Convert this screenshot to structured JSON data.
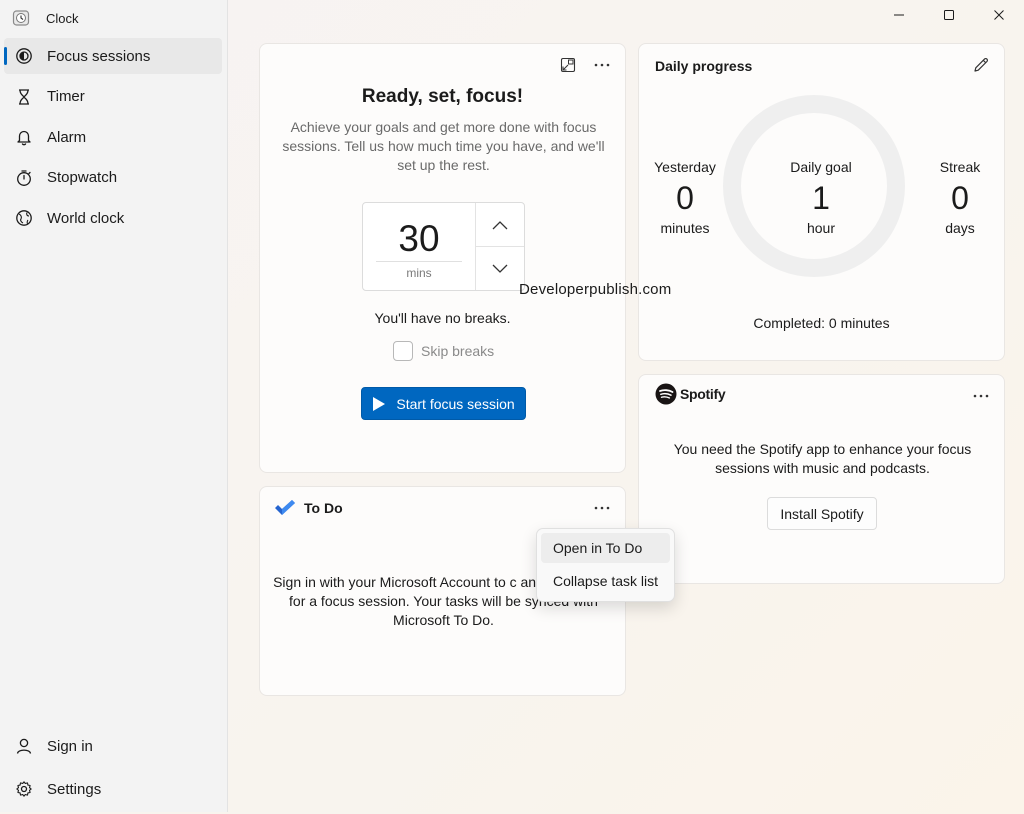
{
  "app": {
    "title": "Clock"
  },
  "sidebar": {
    "items": [
      {
        "label": "Focus sessions",
        "icon": "focus-icon",
        "active": true
      },
      {
        "label": "Timer",
        "icon": "hourglass-icon"
      },
      {
        "label": "Alarm",
        "icon": "bell-icon"
      },
      {
        "label": "Stopwatch",
        "icon": "stopwatch-icon"
      },
      {
        "label": "World clock",
        "icon": "globe-icon"
      }
    ],
    "bottom": [
      {
        "label": "Sign in",
        "icon": "person-icon"
      },
      {
        "label": "Settings",
        "icon": "gear-icon"
      }
    ]
  },
  "focus": {
    "title": "Ready, set, focus!",
    "description": "Achieve your goals and get more done with focus sessions. Tell us how much time you have, and we'll set up the rest.",
    "minutes": "30",
    "unit": "mins",
    "breaks": "You'll have no breaks.",
    "skip_label": "Skip breaks",
    "start_label": "Start focus session"
  },
  "todo": {
    "title": "To Do",
    "message": "Sign in with your Microsoft Account to c      and pick a task for a focus session. Your tasks will be synced with Microsoft To Do."
  },
  "progress": {
    "title": "Daily progress",
    "yesterday": {
      "label": "Yesterday",
      "value": "0",
      "unit": "minutes"
    },
    "goal": {
      "label": "Daily goal",
      "value": "1",
      "unit": "hour"
    },
    "streak": {
      "label": "Streak",
      "value": "0",
      "unit": "days"
    },
    "completed": "Completed: 0 minutes"
  },
  "spotify": {
    "brand": "Spotify",
    "message": "You need the Spotify app to enhance your focus sessions with music and podcasts.",
    "install_label": "Install Spotify"
  },
  "context_menu": {
    "items": [
      "Open in To Do",
      "Collapse task list"
    ]
  },
  "watermark": "Developerpublish.com",
  "colors": {
    "accent": "#0067c0",
    "todo_blue": "#2564cf",
    "ring": "#efefef"
  }
}
